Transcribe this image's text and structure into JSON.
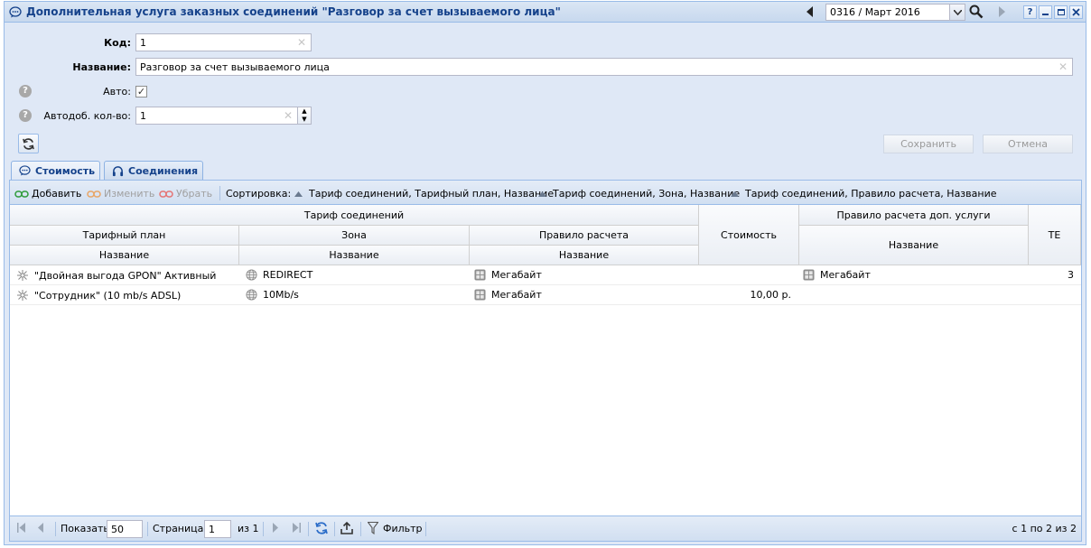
{
  "window": {
    "title": "Дополнительная услуга заказных соединений \"Разговор за счет вызываемого лица\"",
    "period": "0316 / Март 2016",
    "help_label": "?"
  },
  "form": {
    "code_label": "Код:",
    "code_value": "1",
    "name_label": "Название:",
    "name_value": "Разговор за счет вызываемого лица",
    "auto_label": "Авто:",
    "auto_checked": true,
    "autoadd_label": "Автодоб. кол-во:",
    "autoadd_value": "1",
    "help_label": "?",
    "save_label": "Сохранить",
    "cancel_label": "Отмена"
  },
  "tabs": [
    {
      "label": "Стоимость",
      "active": true
    },
    {
      "label": "Соединения",
      "active": false
    }
  ],
  "toolbar": {
    "add_label": "Добавить",
    "edit_label": "Изменить",
    "remove_label": "Убрать",
    "sort_label": "Сортировка:",
    "sort_items": [
      "Тариф соединений, Тарифный план, Название",
      "Тариф соединений, Зона, Название",
      "Тариф соединений, Правило расчета, Название"
    ]
  },
  "columns": {
    "group_tariff": "Тариф соединений",
    "tariff_plan": "Тарифный план",
    "zone": "Зона",
    "calc_rule": "Правило расчета",
    "name1": "Название",
    "name2": "Название",
    "name3": "Название",
    "cost": "Стоимость",
    "group_addon_rule": "Правило расчета доп. услуги",
    "name4": "Название",
    "te": "ТЕ"
  },
  "rows": [
    {
      "plan": "\"Двойная выгода GPON\" Активный",
      "zone": "REDIRECT",
      "rule": "Мегабайт",
      "cost": "",
      "addon_rule": "Мегабайт",
      "te": "3"
    },
    {
      "plan": "\"Сотрудник\" (10 mb/s ADSL)",
      "zone": "10Mb/s",
      "rule": "Мегабайт",
      "cost": "10,00 р.",
      "addon_rule": "",
      "te": ""
    }
  ],
  "pager": {
    "show_label": "Показать",
    "page_size": "50",
    "page_label": "Страница",
    "page_value": "1",
    "of_label": "из 1",
    "filter_label": "Фильтр",
    "summary": "с 1 по 2 из 2"
  }
}
